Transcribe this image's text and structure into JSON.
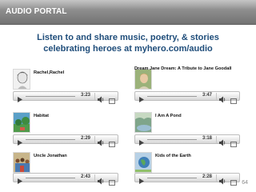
{
  "header": {
    "title": "AUDIO PORTAL",
    "bg_color": "#8c8c8c"
  },
  "subtitle": {
    "line1": "Listen to and share music, poetry, & stories",
    "line2": "celebrating heroes at myhero.com/audio",
    "color": "#1f4d7a"
  },
  "entries": [
    {
      "title": "Rachel,Rachel",
      "time": "3:23",
      "icon": "portrait-sketch-icon"
    },
    {
      "title": "Dream Jane Dream: A Tribute to Jane Goodall",
      "time": "3:47",
      "icon": "jane-goodall-photo-icon"
    },
    {
      "title": "Habitat",
      "time": "2:29",
      "icon": "habitat-art-icon"
    },
    {
      "title": "I Am A Pond",
      "time": "3:18",
      "icon": "pond-scene-icon"
    },
    {
      "title": "Uncle Jonathan",
      "time": "2:43",
      "icon": "crowd-photo-icon"
    },
    {
      "title": "Kids of the Earth",
      "time": "2:28",
      "icon": "earth-kids-icon"
    }
  ],
  "player_icons": [
    "play-icon",
    "volume-icon",
    "fullscreen-icon"
  ],
  "page_number": "64"
}
